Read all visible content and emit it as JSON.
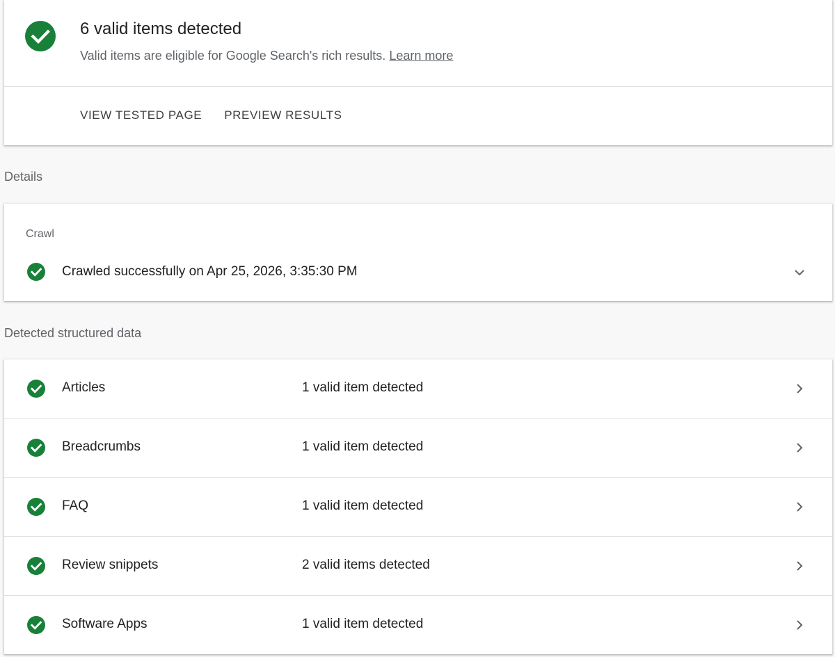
{
  "summary": {
    "title": "6 valid items detected",
    "subtitle": "Valid items are eligible for Google Search's rich results.",
    "learn_more": "Learn more",
    "actions": [
      "VIEW TESTED PAGE",
      "PREVIEW RESULTS"
    ],
    "icon": "check-circle-icon"
  },
  "details": {
    "label": "Details",
    "crawl": {
      "heading": "Crawl",
      "status": "Crawled successfully on Apr 25, 2026, 3:35:30 PM",
      "icon": "check-circle-icon"
    }
  },
  "structured": {
    "label": "Detected structured data",
    "items": [
      {
        "name": "Articles",
        "count": "1 valid item detected"
      },
      {
        "name": "Breadcrumbs",
        "count": "1 valid item detected"
      },
      {
        "name": "FAQ",
        "count": "1 valid item detected"
      },
      {
        "name": "Review snippets",
        "count": "2 valid items detected"
      },
      {
        "name": "Software Apps",
        "count": "1 valid item detected"
      }
    ]
  },
  "colors": {
    "success_green": "#188038",
    "text_primary": "#202124",
    "text_secondary": "#5f6368",
    "background": "#f8f8f8"
  }
}
